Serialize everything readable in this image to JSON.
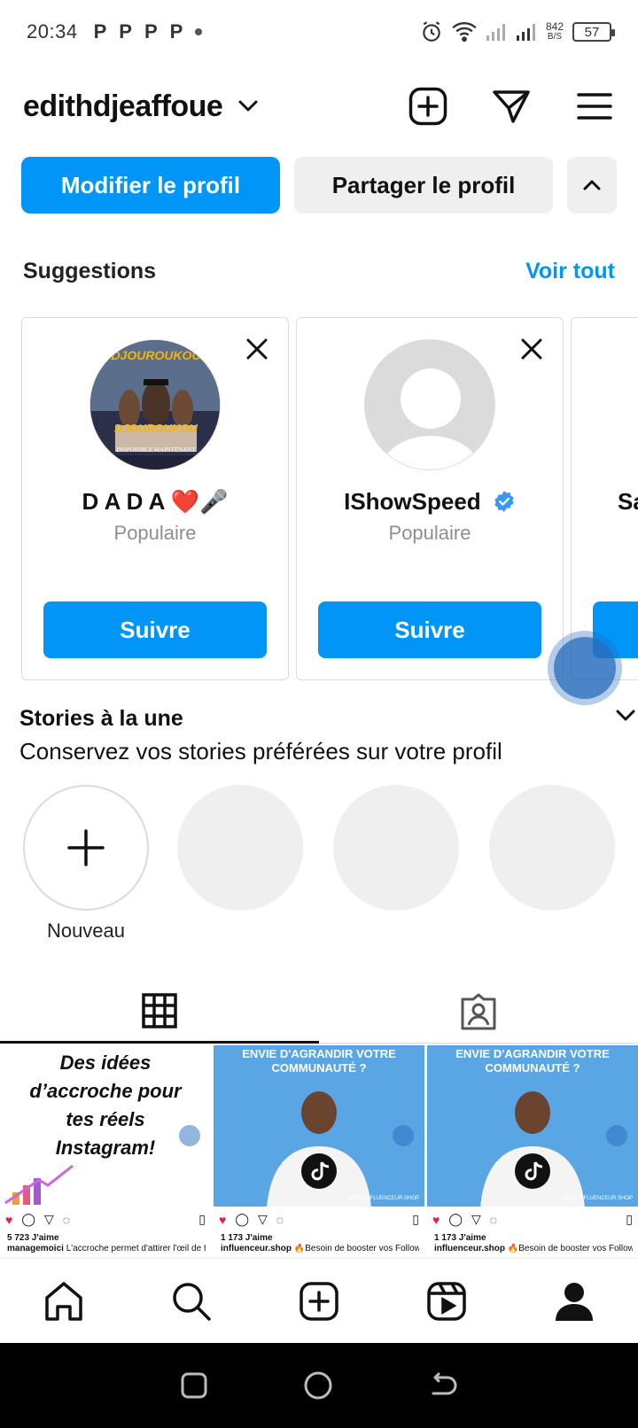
{
  "status_bar": {
    "time": "20:34",
    "p_glyphs": [
      "P",
      "P",
      "P",
      "P"
    ],
    "net_speed_value": "842",
    "net_speed_unit": "B/S",
    "battery": "57"
  },
  "header": {
    "username": "edithdjeaffoue"
  },
  "profile_buttons": {
    "edit": "Modifier le profil",
    "share": "Partager le profil"
  },
  "suggestions": {
    "title": "Suggestions",
    "see_all": "Voir tout",
    "cards": [
      {
        "name": "D A D A ❤️🎤",
        "subtitle": "Populaire",
        "follow": "Suivre",
        "avatar_text_top": "DJOUROUKOU",
        "avatar_text_bottom": "DJOUROUKOU",
        "avatar_caption": "DISPONIBLE MAINTENANT"
      },
      {
        "name": "IShowSpeed",
        "subtitle": "Populaire",
        "follow": "Suivre"
      },
      {
        "name": "Sa"
      }
    ]
  },
  "highlights": {
    "title": "Stories à la une",
    "subtitle": "Conservez vos stories préférées sur votre profil",
    "new_label": "Nouveau"
  },
  "posts": [
    {
      "image_text": [
        "Des idées",
        "d’accroche pour",
        "tes réels",
        "Instagram!"
      ],
      "likes": "5 723 J'aime",
      "author": "managemoici",
      "caption": " L'accroche permet d'attirer l'œil de ton"
    },
    {
      "image_text": [
        "ENVIE D'AGRANDIR VOTRE",
        "COMMUNAUTÉ ?"
      ],
      "footer_url": "WWW.INFLUENCEUR.SHOP",
      "likes": "1 173 J'aime",
      "author": "influenceur.shop",
      "caption": " 🔥Besoin de booster vos Followers,"
    },
    {
      "image_text": [
        "ENVIE D'AGRANDIR VOTRE",
        "COMMUNAUTÉ ?"
      ],
      "footer_url": "WWW.INFLUENCEUR.SHOP",
      "likes": "1 173 J'aime",
      "author": "influenceur.shop",
      "caption": " 🔥Besoin de booster vos Followers,"
    }
  ],
  "colors": {
    "primary_blue": "#0095f6",
    "verified_blue": "#3897f0",
    "like_red": "#ed1c3a",
    "secondary_bg": "#efefef",
    "muted_text": "#8e8e8e"
  },
  "icons": {
    "header": [
      "chevron-down-icon",
      "create-plus-icon",
      "direct-message-icon",
      "menu-icon"
    ],
    "tabs": [
      "grid-icon",
      "tagged-icon"
    ],
    "bottom_nav": [
      "home-icon",
      "search-icon",
      "create-icon",
      "reels-icon",
      "profile-icon"
    ],
    "system_nav": [
      "recents-icon",
      "home-circle-icon",
      "back-icon"
    ]
  }
}
